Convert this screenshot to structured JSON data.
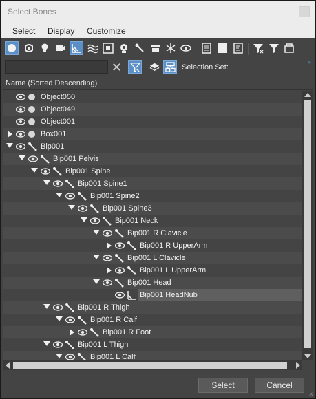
{
  "window": {
    "title": "Select Bones"
  },
  "menu": [
    "Select",
    "Display",
    "Customize"
  ],
  "toolbar": {
    "icons": [
      "geometry-icon",
      "shapes-icon",
      "lights-icon",
      "cameras-icon",
      "bones-icon",
      "spacewarps-icon",
      "groups-icon",
      "xrefs-icon",
      "helpers-icon",
      "frozen-icon",
      "particles-icon",
      "hidden-icon",
      "select-all-icon",
      "select-none-icon",
      "select-invert-icon",
      "filter-icon",
      "funnel-icon",
      "container-icon"
    ]
  },
  "search": {
    "placeholder": "",
    "value": ""
  },
  "selection_set_label": "Selection Set:",
  "column_header": "Name (Sorted Descending)",
  "tree": [
    {
      "label": "Object050",
      "depth": 0,
      "expander": "none",
      "icon": "dot"
    },
    {
      "label": "Object049",
      "depth": 0,
      "expander": "none",
      "icon": "dot"
    },
    {
      "label": "Object001",
      "depth": 0,
      "expander": "none",
      "icon": "dot"
    },
    {
      "label": "Box001",
      "depth": 0,
      "expander": "right",
      "icon": "dot"
    },
    {
      "label": "Bip001",
      "depth": 0,
      "expander": "down",
      "icon": "bone"
    },
    {
      "label": "Bip001 Pelvis",
      "depth": 1,
      "expander": "down",
      "icon": "bone"
    },
    {
      "label": "Bip001 Spine",
      "depth": 2,
      "expander": "down",
      "icon": "bone"
    },
    {
      "label": "Bip001 Spine1",
      "depth": 3,
      "expander": "down",
      "icon": "bone"
    },
    {
      "label": "Bip001 Spine2",
      "depth": 4,
      "expander": "down",
      "icon": "bone"
    },
    {
      "label": "Bip001 Spine3",
      "depth": 5,
      "expander": "down",
      "icon": "bone"
    },
    {
      "label": "Bip001 Neck",
      "depth": 6,
      "expander": "down",
      "icon": "bone"
    },
    {
      "label": "Bip001 R Clavicle",
      "depth": 7,
      "expander": "down",
      "icon": "bone"
    },
    {
      "label": "Bip001 R UpperArm",
      "depth": 8,
      "expander": "right",
      "icon": "bone"
    },
    {
      "label": "Bip001 L Clavicle",
      "depth": 7,
      "expander": "down",
      "icon": "bone"
    },
    {
      "label": "Bip001 L UpperArm",
      "depth": 8,
      "expander": "right",
      "icon": "bone"
    },
    {
      "label": "Bip001 Head",
      "depth": 7,
      "expander": "down",
      "icon": "bone"
    },
    {
      "label": "Bip001 HeadNub",
      "depth": 8,
      "expander": "none",
      "icon": "bonenub",
      "selected": true
    },
    {
      "label": "Bip001 R Thigh",
      "depth": 3,
      "expander": "down",
      "icon": "bone"
    },
    {
      "label": "Bip001 R Calf",
      "depth": 4,
      "expander": "down",
      "icon": "bone"
    },
    {
      "label": "Bip001 R Foot",
      "depth": 5,
      "expander": "right",
      "icon": "bone"
    },
    {
      "label": "Bip001 L Thigh",
      "depth": 3,
      "expander": "down",
      "icon": "bone"
    },
    {
      "label": "Bip001 L Calf",
      "depth": 4,
      "expander": "down",
      "icon": "bone"
    }
  ],
  "buttons": {
    "select": "Select",
    "cancel": "Cancel"
  },
  "colors": {
    "accent": "#5b8fc7",
    "background": "#444444",
    "row_alt": "#4b4b4b"
  }
}
